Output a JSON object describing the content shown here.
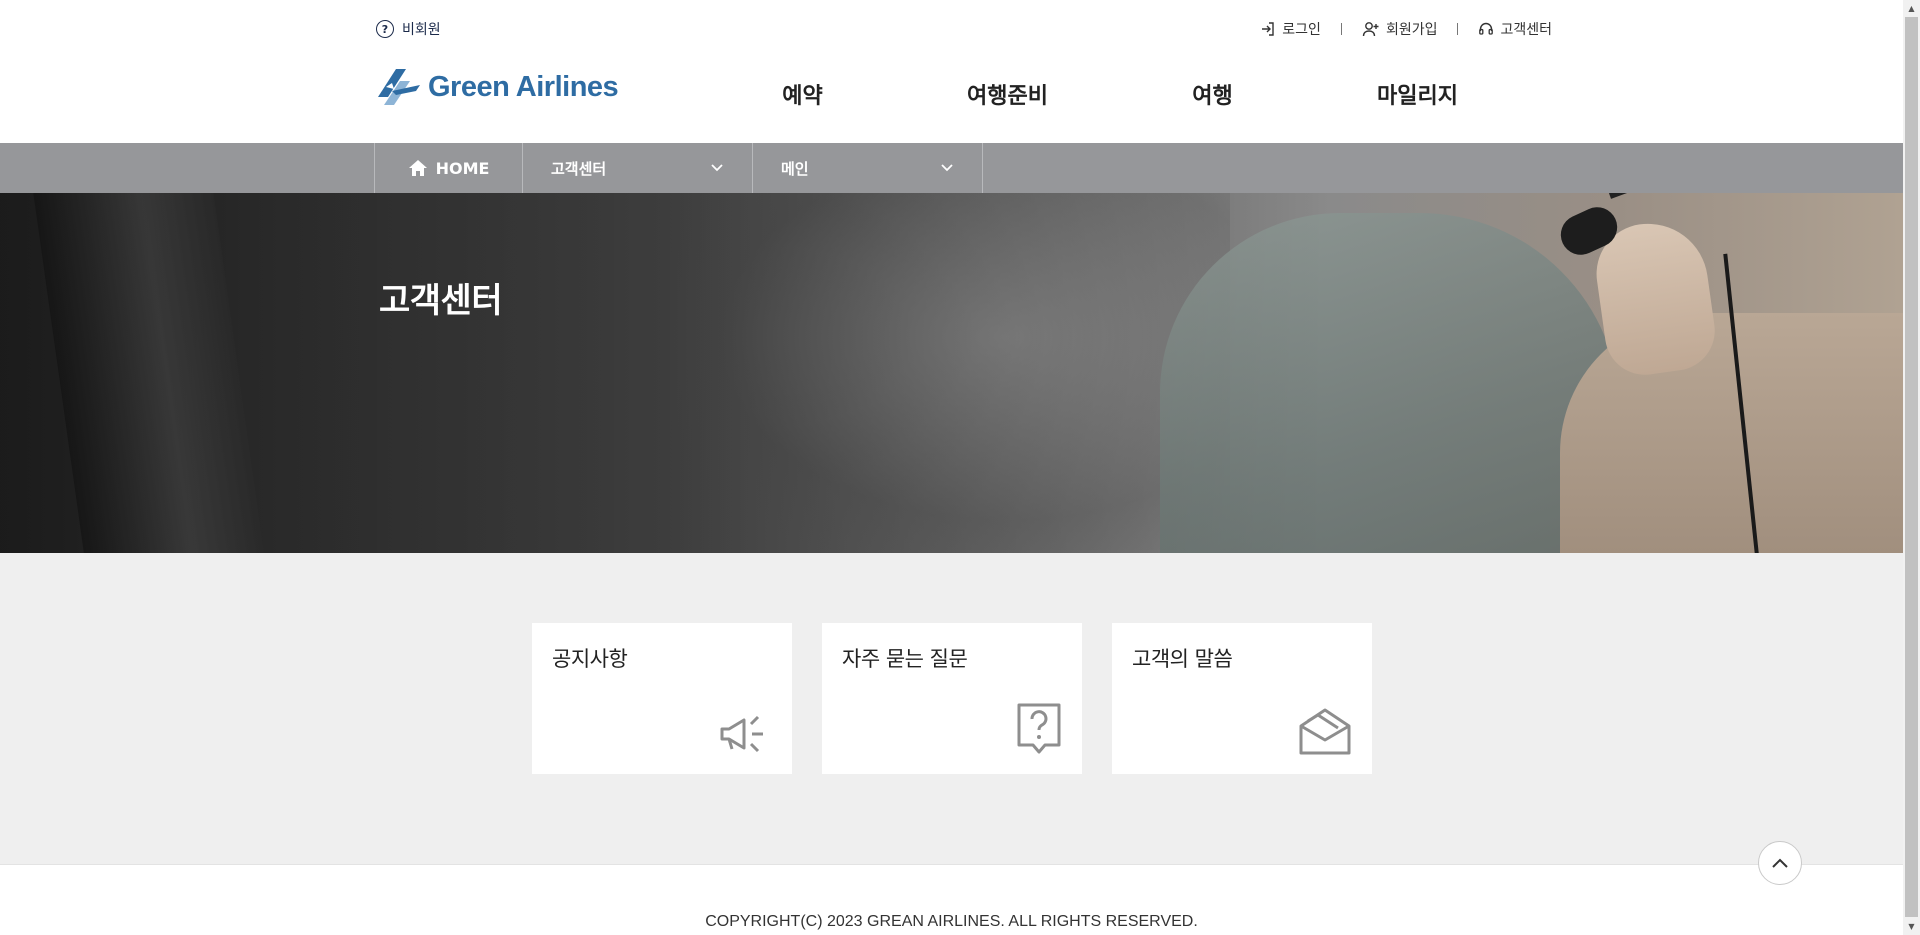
{
  "header": {
    "guest_label": "비회원",
    "util": {
      "login": "로그인",
      "signup": "회원가입",
      "support": "고객센터"
    },
    "logo_text": "Green Airlines",
    "gnb": [
      "예약",
      "여행준비",
      "여행",
      "마일리지"
    ]
  },
  "subnav": {
    "home": "HOME",
    "depth1": "고객센터",
    "depth2": "메인"
  },
  "hero": {
    "title": "고객센터"
  },
  "cards": [
    {
      "title": "공지사항",
      "icon": "megaphone-icon"
    },
    {
      "title": "자주 묻는 질문",
      "icon": "question-bubble-icon"
    },
    {
      "title": "고객의 말씀",
      "icon": "open-envelope-icon"
    }
  ],
  "footer": {
    "copyright": "COPYRIGHT(C) 2023 GREAN AIRLINES. ALL RIGHTS RESERVED."
  },
  "colors": {
    "brand_blue": "#2e6ca3",
    "subnav_gray": "#96979a",
    "content_bg": "#efefef",
    "icon_gray": "#8e8e8e"
  }
}
